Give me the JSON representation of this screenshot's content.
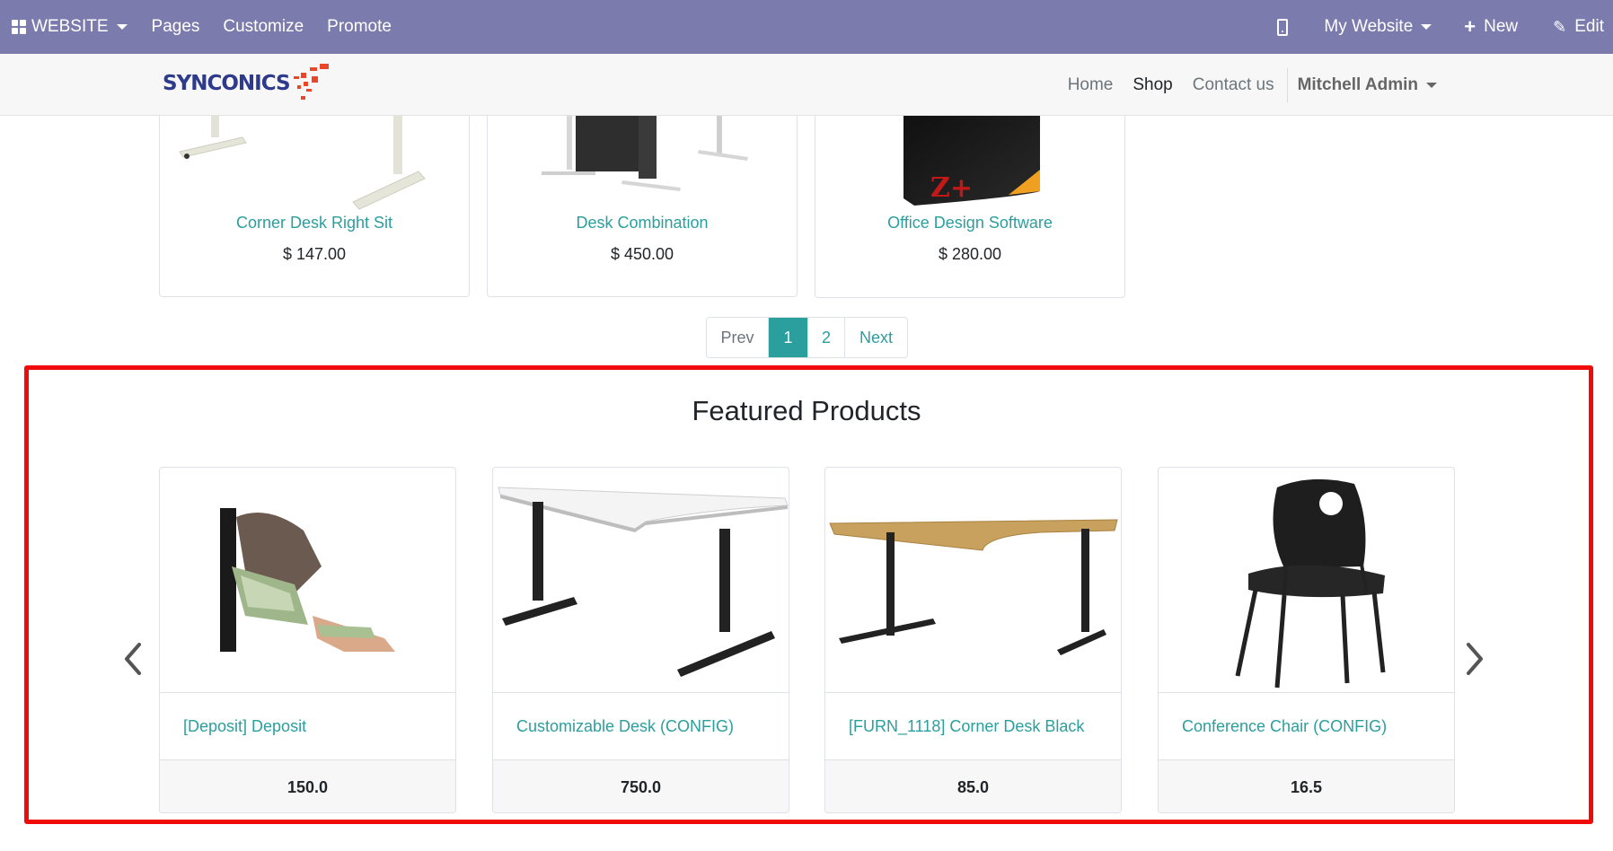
{
  "admin_bar": {
    "app_label": "WEBSITE",
    "menu": [
      "Pages",
      "Customize",
      "Promote"
    ],
    "website_label": "My Website",
    "new_label": "New",
    "edit_label": "Edit",
    "bg_color": "#7c7bad"
  },
  "header": {
    "logo_text": "SYNCONICS",
    "nav": [
      "Home",
      "Shop",
      "Contact us"
    ],
    "active_nav": "Shop",
    "user": "Mitchell Admin"
  },
  "products": [
    {
      "name": "Corner Desk Right Sit",
      "price": "$ 147.00",
      "image": "white-desk-legs"
    },
    {
      "name": "Desk Combination",
      "price": "$ 450.00",
      "image": "desk-combination"
    },
    {
      "name": "Office Design Software",
      "price": "$ 280.00",
      "image": "software-box"
    }
  ],
  "pagination": {
    "prev": "Prev",
    "pages": [
      "1",
      "2"
    ],
    "current": "1",
    "next": "Next"
  },
  "featured": {
    "title": "Featured Products",
    "items": [
      {
        "name": "[Deposit] Deposit",
        "price": "150.0",
        "image": "cash-handover"
      },
      {
        "name": "Customizable Desk (CONFIG)",
        "price": "750.0",
        "image": "white-desk"
      },
      {
        "name": "[FURN_1118] Corner Desk Black",
        "price": "85.0",
        "image": "oak-corner-desk"
      },
      {
        "name": "Conference Chair (CONFIG)",
        "price": "16.5",
        "image": "black-chair"
      }
    ]
  },
  "colors": {
    "accent": "#2b9e9e",
    "highlight": "#f00a0a"
  }
}
